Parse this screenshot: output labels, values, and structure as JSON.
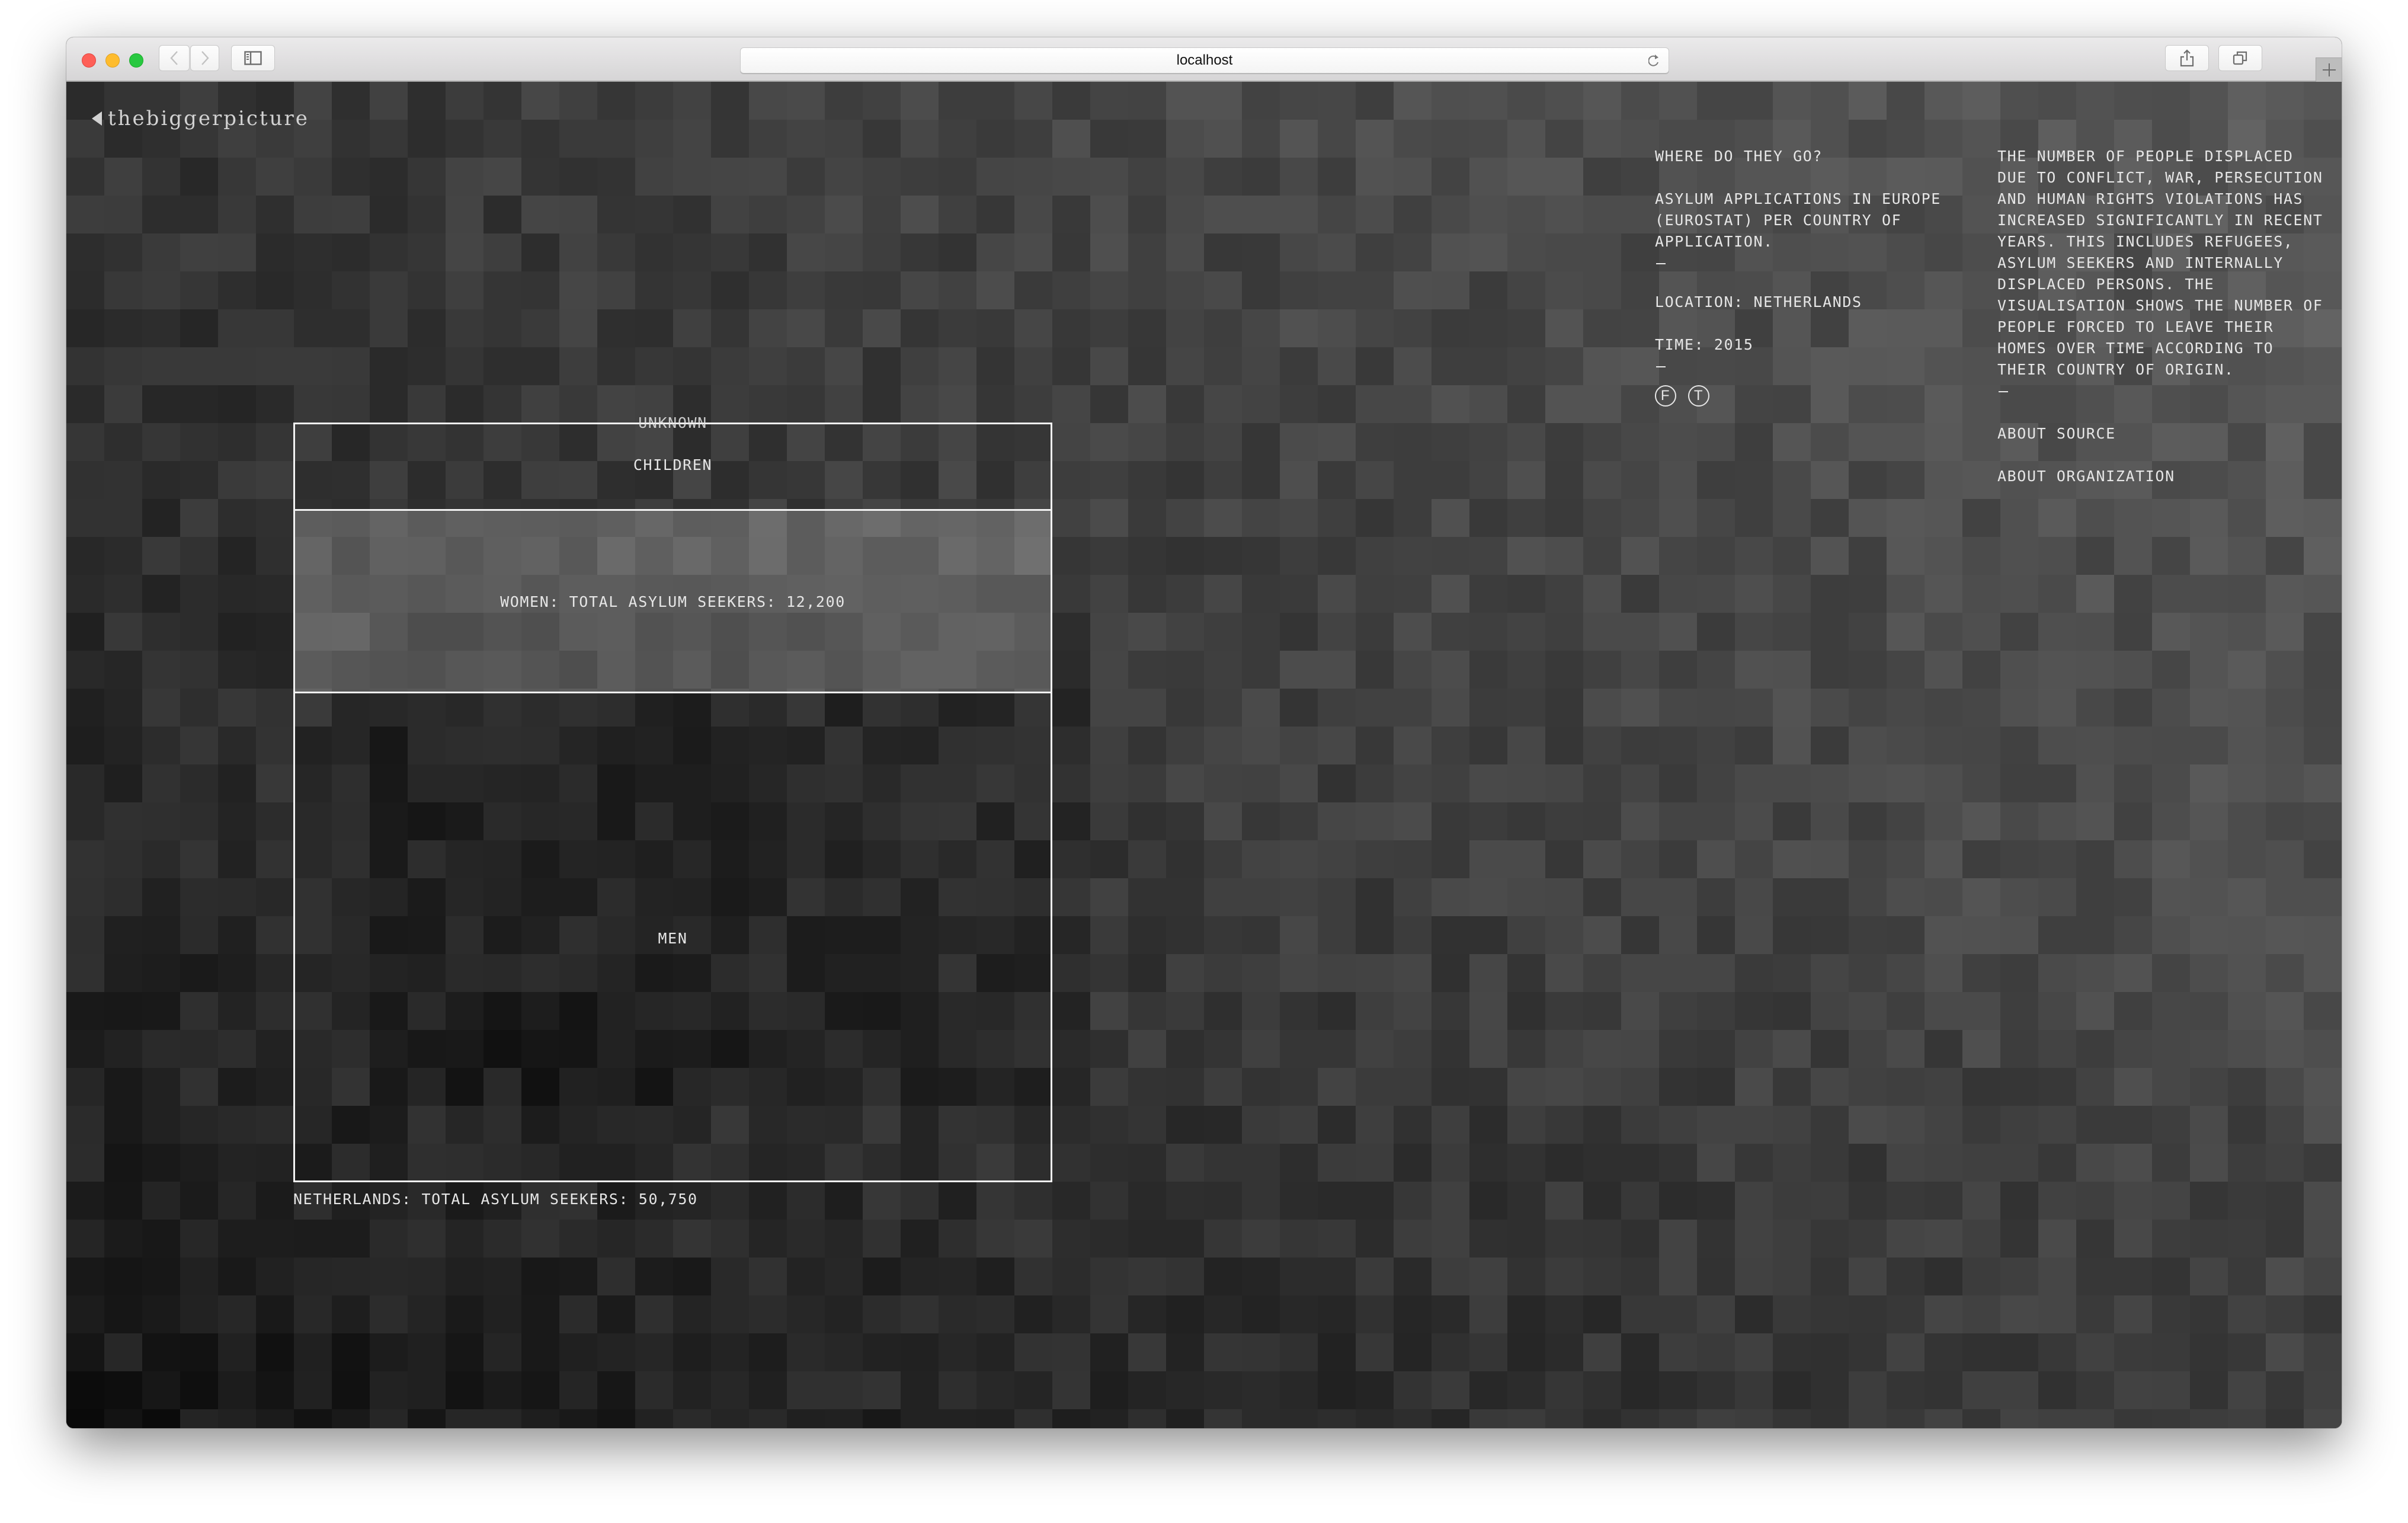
{
  "browser": {
    "url": "localhost",
    "buttons": {
      "back": "back",
      "forward": "forward",
      "sidebar": "sidebar",
      "share": "share",
      "tabs": "tabs",
      "new_tab": "+"
    }
  },
  "brand": {
    "logo_text": "thebiggerpicture",
    "back_icon": "triangle-left"
  },
  "info": {
    "heading": "WHERE DO THEY GO?",
    "description": "ASYLUM APPLICATIONS IN EUROPE (EUROSTAT) PER COUNTRY OF APPLICATION.",
    "location_label": "LOCATION:",
    "location_value": "NETHERLANDS",
    "time_label": "TIME:",
    "time_value": "2015",
    "separator": "—",
    "social": [
      {
        "name": "facebook",
        "glyph": "f"
      },
      {
        "name": "twitter",
        "glyph": "t"
      }
    ]
  },
  "about": {
    "text": "THE NUMBER OF PEOPLE DISPLACED DUE TO CONFLICT, WAR, PERSECUTION AND HUMAN RIGHTS VIOLATIONS HAS INCREASED SIGNIFICANTLY IN RECENT YEARS. THIS INCLUDES REFUGEES, ASYLUM SEEKERS AND INTERNALLY DISPLACED PERSONS. THE VISUALISATION SHOWS THE NUMBER OF PEOPLE FORCED TO LEAVE THEIR HOMES OVER TIME ACCORDING TO THEIR COUNTRY OF ORIGIN.",
    "links": [
      "ABOUT SOURCE",
      "ABOUT ORGANIZATION"
    ]
  },
  "chart_data": {
    "type": "table",
    "title": "NETHERLANDS: TOTAL ASYLUM SEEKERS: 50,750",
    "country": "NETHERLANDS",
    "year": 2015,
    "total": 50750,
    "total_label": "NETHERLANDS: TOTAL ASYLUM SEEKERS: 50,750",
    "segments": [
      {
        "key": "unknown",
        "label": "UNKNOWN",
        "share": 0.0,
        "highlighted": false
      },
      {
        "key": "children",
        "label": "CHILDREN",
        "share": 0.116,
        "highlighted": false
      },
      {
        "key": "women",
        "label": "WOMEN: TOTAL ASYLUM SEEKERS: 12,200",
        "value": 12200,
        "share": 0.24,
        "highlighted": true
      },
      {
        "key": "men",
        "label": "MEN",
        "share": 0.644,
        "highlighted": false
      }
    ]
  },
  "colors": {
    "text": "#e6e6e6",
    "frame": "#f2f2f2",
    "highlight_overlay": "rgba(255,255,255,0.22)"
  }
}
